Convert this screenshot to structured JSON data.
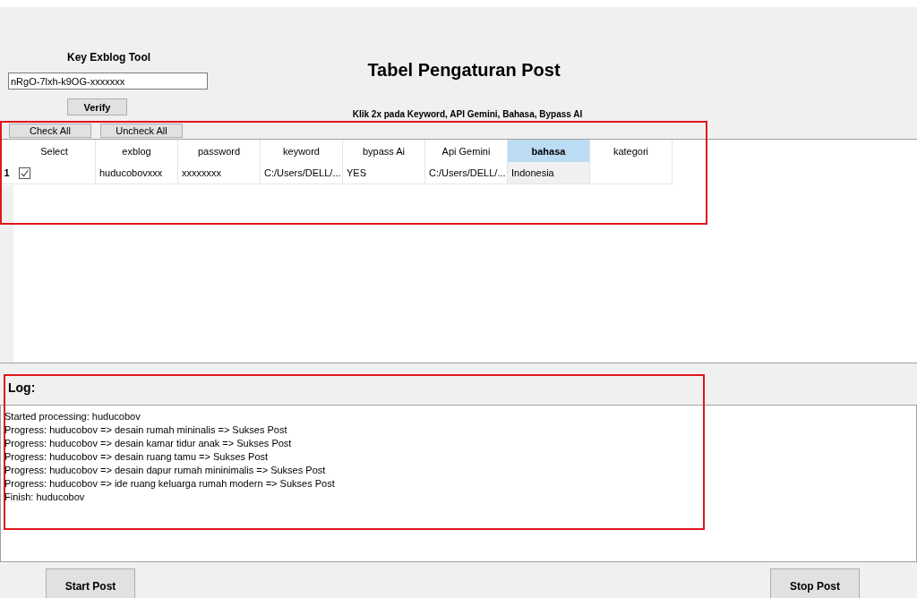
{
  "key_section": {
    "label": "Key Exblog Tool",
    "key_value": "nRgO-7lxh-k9OG-xxxxxxx",
    "verify_button": "Verify"
  },
  "title": "Tabel Pengaturan Post",
  "hint": "Klik 2x pada Keyword, API Gemini, Bahasa, Bypass AI",
  "buttons": [
    "Check All",
    "Uncheck All"
  ],
  "table": {
    "columns": [
      {
        "label": "Select",
        "selected": false
      },
      {
        "label": "exblog",
        "selected": false
      },
      {
        "label": "password",
        "selected": false
      },
      {
        "label": "keyword",
        "selected": false
      },
      {
        "label": "bypass Ai",
        "selected": false
      },
      {
        "label": "Api Gemini",
        "selected": false
      },
      {
        "label": "bahasa",
        "selected": true
      },
      {
        "label": "kategori",
        "selected": false
      }
    ],
    "rows": [
      {
        "number": "1",
        "cells": [
          {
            "kind": "checkbox",
            "checked": true,
            "selected": false
          },
          {
            "text": "huducobovxxx",
            "selected": false
          },
          {
            "text": "xxxxxxxx",
            "selected": false
          },
          {
            "text": "C:/Users/DELL/...",
            "selected": false
          },
          {
            "text": "YES",
            "selected": false
          },
          {
            "text": "C:/Users/DELL/...",
            "selected": false
          },
          {
            "text": "Indonesia",
            "selected": true
          },
          {
            "selected": false
          }
        ]
      }
    ]
  },
  "log": {
    "label": "Log:",
    "lines": [
      "Started processing: huducobov",
      "Progress: huducobov => desain rumah mininalis => Sukses Post",
      "Progress: huducobov => desain kamar tidur anak => Sukses Post",
      "Progress: huducobov => desain ruang tamu => Sukses Post",
      "Progress: huducobov => desain dapur rumah mininimalis => Sukses Post",
      "Progress: huducobov => ide ruang keluarga rumah modern => Sukses Post",
      "Finish: huducobov"
    ]
  },
  "actions": [
    "Start Post",
    "Stop Post"
  ]
}
